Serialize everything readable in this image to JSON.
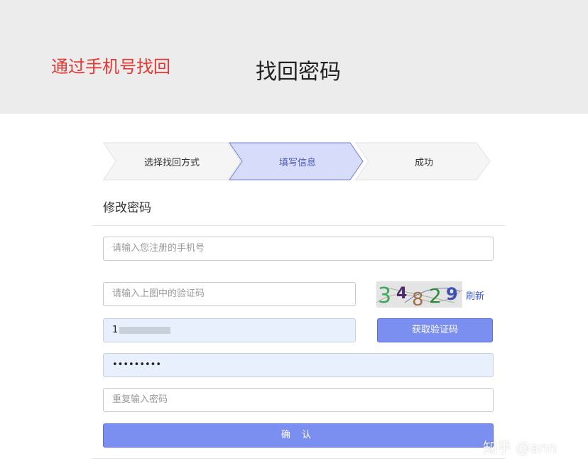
{
  "header": {
    "annotation": "通过手机号找回",
    "title": "找回密码",
    "annotation_color": "#e53935"
  },
  "steps": [
    {
      "label": "选择找回方式",
      "state": "done"
    },
    {
      "label": "填写信息",
      "state": "active"
    },
    {
      "label": "成功",
      "state": "pending"
    }
  ],
  "form": {
    "section_title": "修改密码",
    "phone_placeholder": "请输入您注册的手机号",
    "captcha_placeholder": "请输入上图中的验证码",
    "captcha_text": "34829",
    "refresh_label": "刷新",
    "sms_code_value_prefix": "1",
    "get_code_label": "获取验证码",
    "password_value": "•••••••••",
    "repeat_password_placeholder": "重复输入密码",
    "confirm_label": "确 认"
  },
  "watermark": "知乎 @ann",
  "colors": {
    "accent": "#7a8ff0",
    "active_step_fill": "#d6dcfa",
    "link": "#3b5bdb"
  }
}
